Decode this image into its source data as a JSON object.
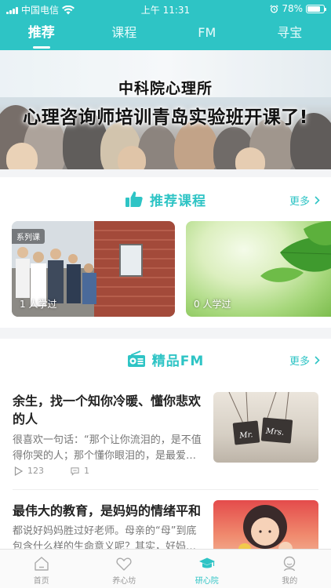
{
  "status_bar": {
    "carrier": "中国电信",
    "time": "上午 11:31",
    "battery": "78%",
    "battery_level": 0.78,
    "icons": [
      "signal-icon",
      "wifi-icon",
      "alarm-icon",
      "battery-icon"
    ]
  },
  "top_tabs": [
    {
      "label": "推荐",
      "active": true
    },
    {
      "label": "课程",
      "active": false
    },
    {
      "label": "FM",
      "active": false
    },
    {
      "label": "寻宝",
      "active": false
    }
  ],
  "banner": {
    "subtitle": "中科院心理所",
    "title": "心理咨询师培训青岛实验班开课了!"
  },
  "recommended_courses": {
    "title": "推荐课程",
    "more": "更多",
    "icon": "thumbs-up-icon",
    "items": [
      {
        "badge": "系列课",
        "learned": "1 人学过"
      },
      {
        "badge": "",
        "learned": "0 人学过"
      }
    ]
  },
  "fm": {
    "title": "精品FM",
    "more": "更多",
    "icon": "radio-icon",
    "items": [
      {
        "title": "余生，找一个知你冷暖、懂你悲欢的人",
        "desc": "很喜欢一句话：“那个让你流泪的，是不值得你哭的人；那个懂你眼泪的，是最爱…",
        "plays": "123",
        "comments": "1",
        "thumb_text": [
          "Mr.",
          "Mrs."
        ]
      },
      {
        "title": "最伟大的教育，是妈妈的情绪平和",
        "desc": "都说好妈妈胜过好老师。母亲的“母”到底包含什么样的生命意义呢？其实，好妈…"
      }
    ]
  },
  "bottom_nav": [
    {
      "label": "首页",
      "icon": "home-icon",
      "active": false
    },
    {
      "label": "养心坊",
      "icon": "heart-icon",
      "active": false
    },
    {
      "label": "研心院",
      "icon": "graduation-cap-icon",
      "active": true
    },
    {
      "label": "我的",
      "icon": "user-icon",
      "active": false
    }
  ],
  "colors": {
    "accent": "#2ec4c5",
    "text": "#222222",
    "muted": "#777777"
  }
}
